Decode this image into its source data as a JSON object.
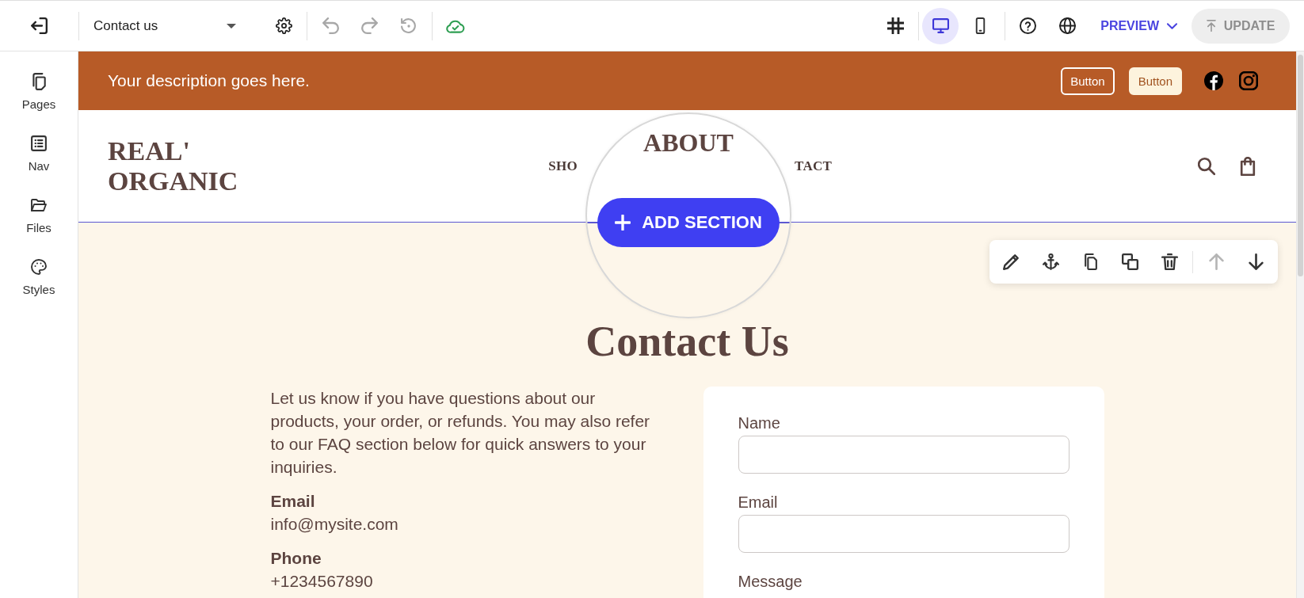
{
  "topbar": {
    "page_select": {
      "value": "Contact us"
    },
    "history": [
      {
        "kind": "undo",
        "disabled": true
      },
      {
        "kind": "redo",
        "disabled": true
      },
      {
        "kind": "restore",
        "disabled": true
      }
    ],
    "views": [
      {
        "kind": "desktop",
        "selected": true
      },
      {
        "kind": "mobile",
        "selected": false
      }
    ],
    "preview": {
      "label": "PREVIEW"
    },
    "update": {
      "label": "UPDATE",
      "disabled": true
    }
  },
  "sidebar": {
    "items": [
      {
        "kind": "pages",
        "label": "Pages"
      },
      {
        "kind": "nav",
        "label": "Nav"
      },
      {
        "kind": "files",
        "label": "Files"
      },
      {
        "kind": "styles",
        "label": "Styles"
      }
    ]
  },
  "announcement_bar": {
    "text": "Your description goes here.",
    "buttons": [
      {
        "kind": "outline",
        "label": "Button"
      },
      {
        "kind": "filled",
        "label": "Button"
      }
    ],
    "social": [
      {
        "kind": "facebook"
      },
      {
        "kind": "instagram"
      }
    ]
  },
  "header": {
    "logo": "REAL' ORGANIC",
    "nav": [
      {
        "label": "SHO"
      },
      {
        "label": "TACT"
      }
    ]
  },
  "magnifier": {
    "nav_label": "ABOUT",
    "add_section": {
      "label": "ADD SECTION"
    }
  },
  "section_toolbar": [
    {
      "kind": "edit",
      "disabled": false
    },
    {
      "kind": "anchor",
      "disabled": false
    },
    {
      "kind": "copy",
      "disabled": false
    },
    {
      "kind": "duplicate",
      "disabled": false
    },
    {
      "kind": "delete",
      "disabled": false
    },
    {
      "kind": "move_up",
      "disabled": true
    },
    {
      "kind": "move_down",
      "disabled": false
    }
  ],
  "contact": {
    "title": "Contact Us",
    "intro": "Let us know if you have questions about our products, your order, or refunds. You may also refer to our FAQ section below for quick answers to your inquiries.",
    "details": [
      {
        "label": "Email",
        "value": "info@mysite.com"
      },
      {
        "label": "Phone",
        "value": "+1234567890"
      }
    ],
    "form": {
      "fields": [
        {
          "kind": "input",
          "label": "Name"
        },
        {
          "kind": "input",
          "label": "Email"
        },
        {
          "kind": "label",
          "label": "Message"
        }
      ]
    }
  }
}
